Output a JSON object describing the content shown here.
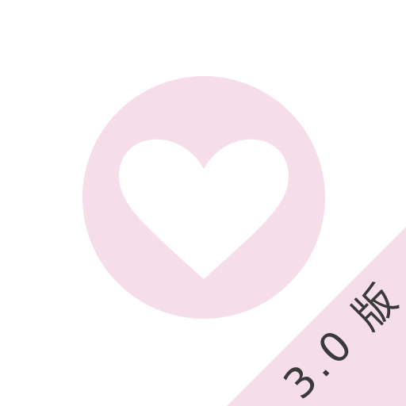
{
  "app_icon": {
    "icon": "heart-icon",
    "circle_color": "#f5dde9",
    "heart_color": "#ffffff"
  },
  "banner": {
    "label": "3.0 版",
    "background_color": "#f5dde9",
    "text_color": "#3a3a3a"
  }
}
